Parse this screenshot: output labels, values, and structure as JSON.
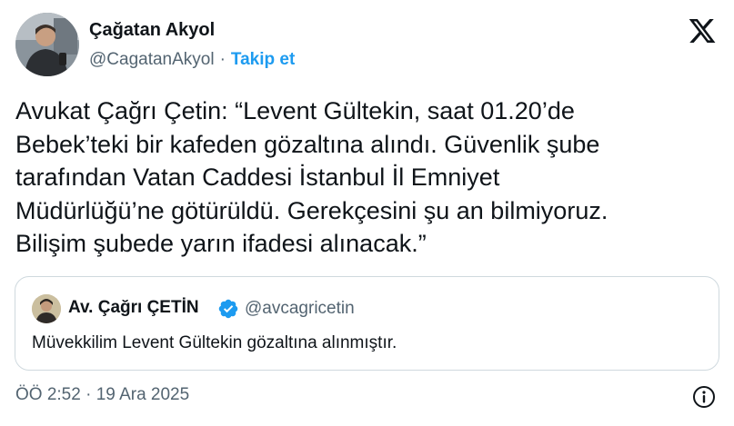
{
  "author": {
    "name": "Çağatan Akyol",
    "handle": "@CagatanAkyol",
    "separator": "·",
    "follow_label": "Takip et"
  },
  "tweet": {
    "lines": [
      "Avukat Çağrı Çetin: “Levent Gültekin, saat 01.20’de",
      "Bebek’teki bir kafeden gözaltına alındı. Güvenlik şube",
      "tarafından Vatan Caddesi İstanbul İl Emniyet",
      "Müdürlüğü’ne götürüldü. Gerekçesini şu an bilmiyoruz.",
      "Bilişim şubede yarın ifadesi alınacak.”"
    ]
  },
  "quote": {
    "name": "Av. Çağrı ÇETİN",
    "handle": "@avcagricetin",
    "text": "Müvekkilim Levent Gültekin gözaltına alınmıştır."
  },
  "footer": {
    "timestamp": "ÖÖ 2:52 · 19 Ara 2025"
  },
  "icons": {
    "logo": "x-logo-icon",
    "verified": "verified-badge-icon",
    "info": "info-icon"
  },
  "colors": {
    "link": "#1d9bf0",
    "text": "#0f1419",
    "secondary": "#536471",
    "border": "#cfd9de"
  }
}
